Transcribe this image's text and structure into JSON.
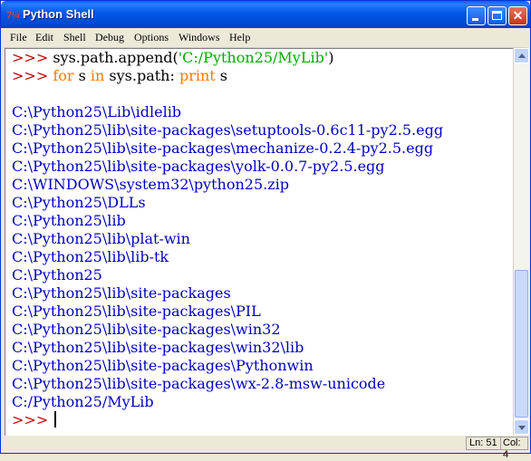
{
  "window": {
    "title": "Python Shell",
    "icon": "python-icon",
    "icon_glyph": "7¼",
    "close_glyph": "✕",
    "accent_color": "#0058e6"
  },
  "menu": {
    "file": "File",
    "edit": "Edit",
    "shell": "Shell",
    "debug": "Debug",
    "options": "Options",
    "windows": "Windows",
    "help": "Help"
  },
  "shell": {
    "prompt": ">>> ",
    "command1": {
      "pre": "sys.path.append(",
      "string": "'C:/Python25/MyLib'",
      "post": ")"
    },
    "command2": {
      "kw_for": "for",
      "s1": " s ",
      "kw_in": "in",
      "mid": " sys.path: ",
      "kw_print": "print",
      "post": " s"
    },
    "output": [
      "",
      "C:\\Python25\\Lib\\idlelib",
      "C:\\Python25\\lib\\site-packages\\setuptools-0.6c11-py2.5.egg",
      "C:\\Python25\\lib\\site-packages\\mechanize-0.2.4-py2.5.egg",
      "C:\\Python25\\lib\\site-packages\\yolk-0.0.7-py2.5.egg",
      "C:\\WINDOWS\\system32\\python25.zip",
      "C:\\Python25\\DLLs",
      "C:\\Python25\\lib",
      "C:\\Python25\\lib\\plat-win",
      "C:\\Python25\\lib\\lib-tk",
      "C:\\Python25",
      "C:\\Python25\\lib\\site-packages",
      "C:\\Python25\\lib\\site-packages\\PIL",
      "C:\\Python25\\lib\\site-packages\\win32",
      "C:\\Python25\\lib\\site-packages\\win32\\lib",
      "C:\\Python25\\lib\\site-packages\\Pythonwin",
      "C:\\Python25\\lib\\site-packages\\wx-2.8-msw-unicode",
      "C:/Python25/MyLib"
    ],
    "final_prompt": ">>> "
  },
  "status": {
    "line": "Ln: 51",
    "col": "Col: 4"
  }
}
